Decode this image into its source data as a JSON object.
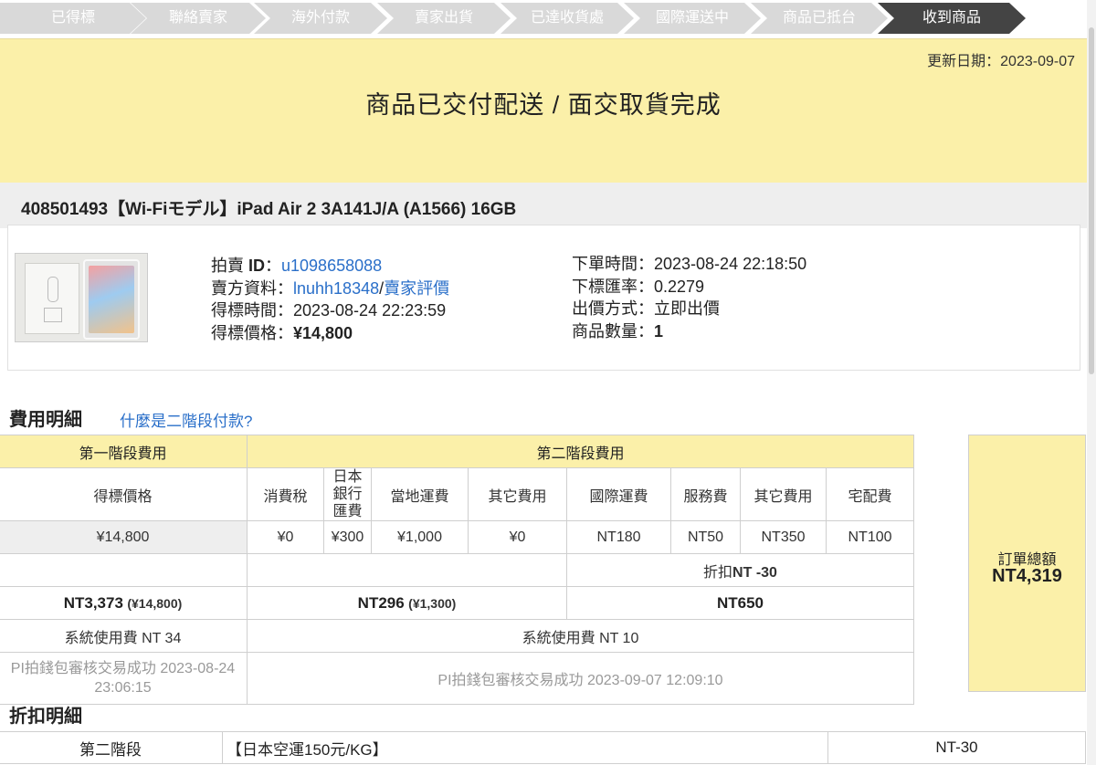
{
  "steps": [
    "已得標",
    "聯絡賣家",
    "海外付款",
    "賣家出貨",
    "已達收貨處",
    "國際運送中",
    "商品已抵台",
    "收到商品"
  ],
  "status": {
    "update_label": "更新日期：",
    "update_date": "2023-09-07",
    "message": "商品已交付配送 / 面交取貨完成"
  },
  "item": {
    "title": "408501493【Wi-Fiモデル】iPad Air 2 3A141J/A (A1566) 16GB",
    "image_alt": "iPad Air 2 product photo",
    "left": {
      "auction_id_label": "拍賣 ",
      "auction_id_key": "ID",
      "auction_id_sep": "：",
      "auction_id": "u1098658088",
      "seller_label": "賣方資料：",
      "seller_name": "lnuhh18348",
      "seller_sep": "/",
      "seller_rating": "賣家評價",
      "win_time_label": "得標時間：",
      "win_time": "2023-08-24 22:23:59",
      "win_price_label": "得標價格：",
      "win_price": "¥14,800"
    },
    "right": {
      "order_time_label": "下單時間：",
      "order_time": "2023-08-24 22:18:50",
      "rate_label": "下標匯率：",
      "rate": "0.2279",
      "bid_method_label": "出價方式：",
      "bid_method": "立即出價",
      "qty_label": "商品數量：",
      "qty": "1"
    }
  },
  "fees": {
    "section_title": "費用明細",
    "help_link": "什麼是二階段付款?",
    "stage1_header": "第一階段費用",
    "stage2_header": "第二階段費用",
    "stage1_col": "得標價格",
    "stage2_cols": [
      "消費稅",
      "日本銀行匯費",
      "當地運費",
      "其它費用",
      "國際運費",
      "服務費",
      "其它費用",
      "宅配費"
    ],
    "stage1_value": "¥14,800",
    "stage2_values": [
      "¥0",
      "¥300",
      "¥1,000",
      "¥0",
      "NT180",
      "NT50",
      "NT350",
      "NT100"
    ],
    "discount_label": "折扣",
    "discount_value": "NT -30",
    "stage1_total": "NT3,373",
    "stage1_total_yen": "(¥14,800)",
    "stage2a_total": "NT296",
    "stage2a_total_yen": "(¥1,300)",
    "stage2b_total": "NT650",
    "sys_fee1": "系統使用費 NT 34",
    "sys_fee2": "系統使用費 NT 10",
    "pay_status1": "PI拍錢包審核交易成功 2023-08-24 23:06:15",
    "pay_status2": "PI拍錢包審核交易成功 2023-09-07 12:09:10",
    "order_total_label": "訂單總額",
    "order_total": "NT4,319"
  },
  "discount": {
    "section_title": "折扣明細",
    "stage": "第二階段",
    "desc": "【日本空運150元/KG】",
    "amount": "NT-30"
  },
  "colors": {
    "banner": "#fbf0a9",
    "active_step": "#444444",
    "link": "#2a6fc9"
  }
}
